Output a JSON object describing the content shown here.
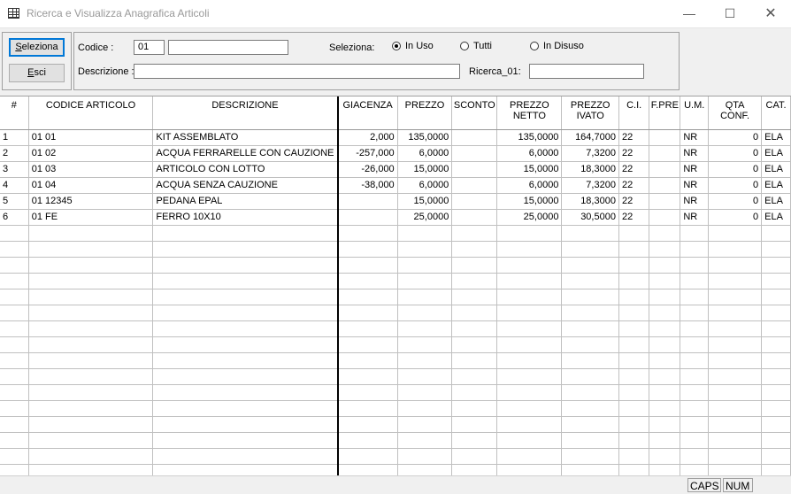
{
  "window": {
    "title": "Ricerca e Visualizza Anagrafica Articoli",
    "min": "—",
    "max": "☐",
    "close": "✕"
  },
  "toolbar": {
    "seleziona": "Seleziona",
    "esci": "Esci"
  },
  "filter": {
    "codice_label": "Codice :",
    "codice_value": "01",
    "codice_extra": "",
    "descrizione_label": "Descrizione :",
    "descrizione_value": "",
    "seleziona_label": "Seleziona:",
    "radio_in_uso": "In Uso",
    "radio_tutti": "Tutti",
    "radio_in_disuso": "In Disuso",
    "selected_radio": "In Uso",
    "ricerca_label": "Ricerca_01:",
    "ricerca_value": ""
  },
  "grid": {
    "headers": [
      "#",
      "CODICE ARTICOLO",
      "DESCRIZIONE",
      "GIACENZA",
      "PREZZO",
      "SCONTO",
      "PREZZO NETTO",
      "PREZZO IVATO",
      "C.I.",
      "F.PRE",
      "U.M.",
      "QTA CONF.",
      "CAT."
    ],
    "rows": [
      [
        "1",
        "01 01",
        "KIT ASSEMBLATO",
        "2,000",
        "135,0000",
        "",
        "135,0000",
        "164,7000",
        "22",
        "",
        "NR",
        "0",
        "ELA"
      ],
      [
        "2",
        "01 02",
        "ACQUA FERRARELLE CON CAUZIONE",
        "-257,000",
        "6,0000",
        "",
        "6,0000",
        "7,3200",
        "22",
        "",
        "NR",
        "0",
        "ELA"
      ],
      [
        "3",
        "01 03",
        "ARTICOLO CON LOTTO",
        "-26,000",
        "15,0000",
        "",
        "15,0000",
        "18,3000",
        "22",
        "",
        "NR",
        "0",
        "ELA"
      ],
      [
        "4",
        "01 04",
        "ACQUA SENZA CAUZIONE",
        "-38,000",
        "6,0000",
        "",
        "6,0000",
        "7,3200",
        "22",
        "",
        "NR",
        "0",
        "ELA"
      ],
      [
        "5",
        "01 12345",
        "PEDANA EPAL",
        "",
        "15,0000",
        "",
        "15,0000",
        "18,3000",
        "22",
        "",
        "NR",
        "0",
        "ELA"
      ],
      [
        "6",
        "01 FE",
        "FERRO 10X10",
        "",
        "25,0000",
        "",
        "25,0000",
        "30,5000",
        "22",
        "",
        "NR",
        "0",
        "ELA"
      ]
    ]
  },
  "status": {
    "caps": "CAPS",
    "num": "NUM"
  }
}
